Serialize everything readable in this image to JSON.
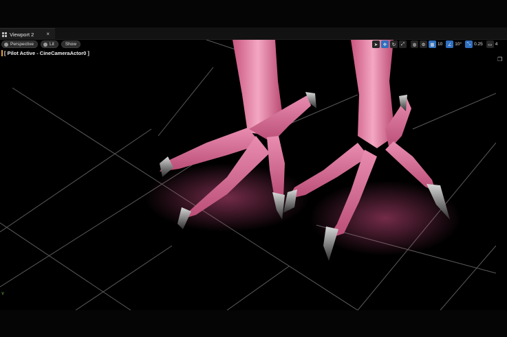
{
  "window": {
    "tab_title": "Viewport 2",
    "tab_close": "×",
    "minimize": "—",
    "maximize": "❐"
  },
  "viewport": {
    "view_mode": "Perspective",
    "lighting_mode": "Lit",
    "show_menu": "Show",
    "pilot_label": "[ Pilot Active - CineCameraActor0 ]",
    "axis_label": "Y"
  },
  "toolbar_right": {
    "tools": [
      {
        "name": "select-icon",
        "glyph": "➤",
        "active": false
      },
      {
        "name": "translate-icon",
        "glyph": "✥",
        "active": true
      },
      {
        "name": "rotate-icon",
        "glyph": "↻",
        "active": false
      },
      {
        "name": "scale-icon",
        "glyph": "⤢",
        "active": false
      }
    ],
    "grid_snap_value": "10",
    "rotation_snap_value": "10°",
    "scale_snap_value": "0.25",
    "camera_speed_value": "4"
  },
  "colors": {
    "accent_blue": "#2f6fbf",
    "pilot_bar": "#e8a33a",
    "axis_green": "#7ad44a"
  }
}
